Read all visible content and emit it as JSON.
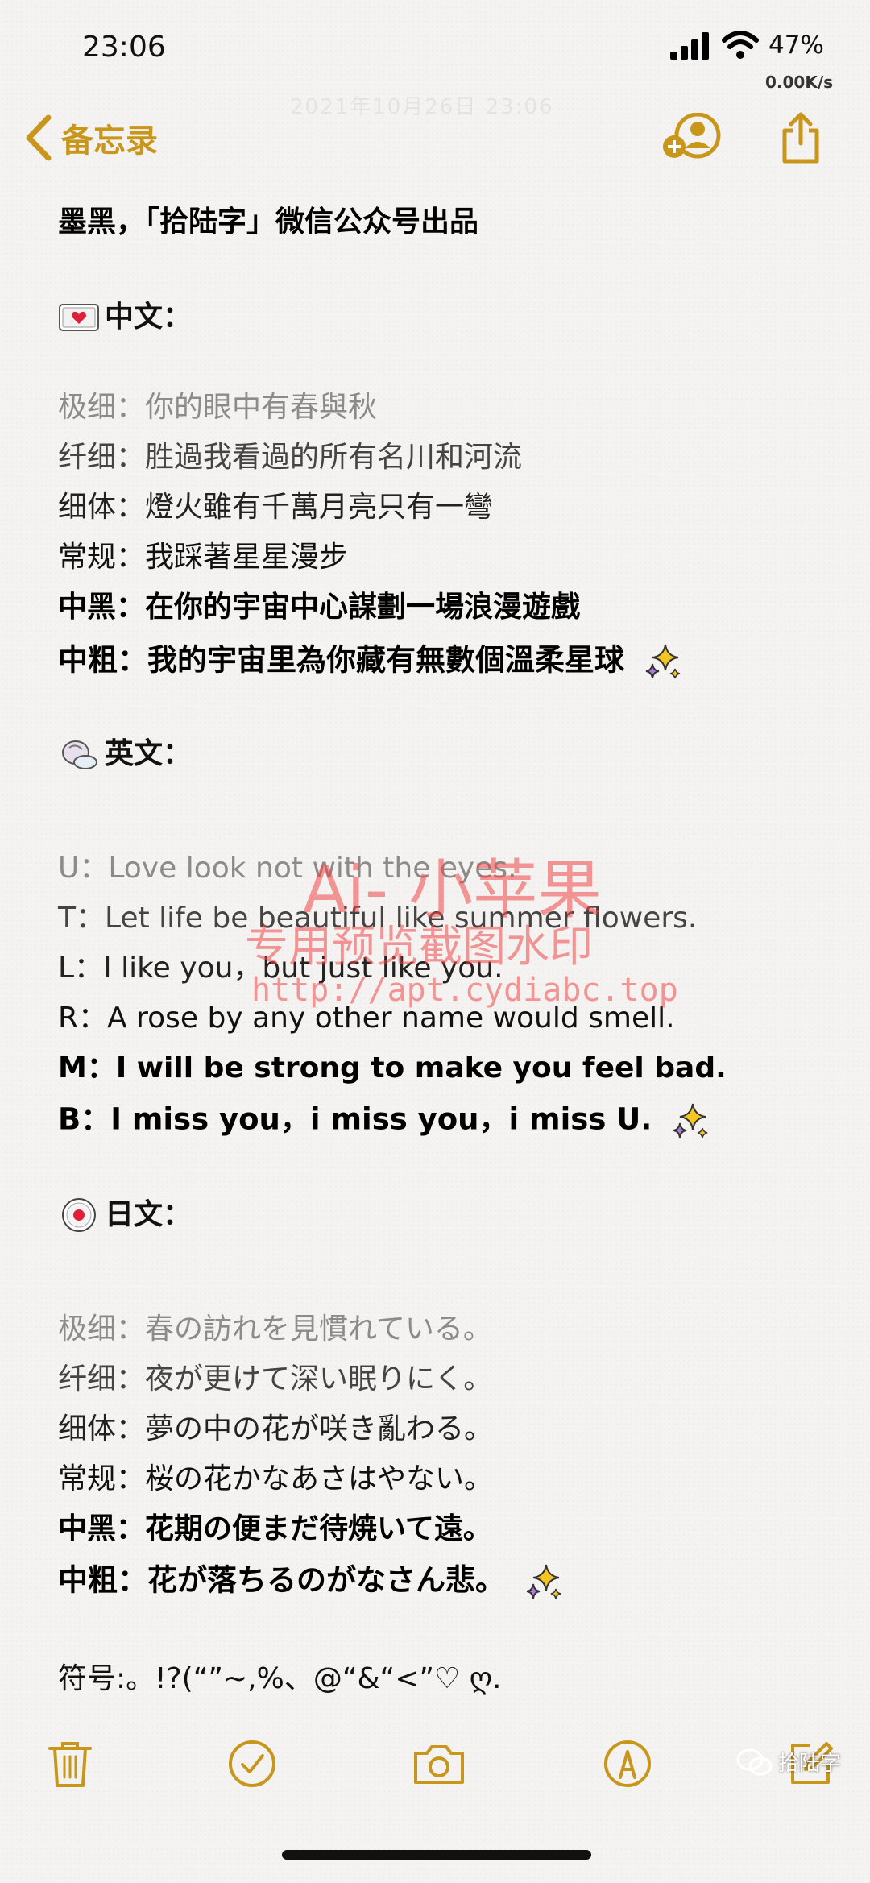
{
  "status_bar": {
    "time": "23:06",
    "battery": "47%",
    "net_speed": "0.00K/s",
    "faint_date": "2021年10月26日 23:06"
  },
  "nav": {
    "back_label": "备忘录",
    "accent_color": "#c8961a"
  },
  "note": {
    "title": "墨黑，「拾陆字」微信公众号出品",
    "sections": {
      "chinese": {
        "heading": "中文：",
        "icon": "flag-envelope-icon",
        "lines": [
          "极细：你的眼中有春與秋",
          "纤细：胜過我看過的所有名川和河流",
          "细体：燈火雖有千萬月亮只有一彎",
          "常规：我踩著星星漫步",
          "中黑：在你的宇宙中心謀劃一場浪漫遊戲",
          "中粗：我的宇宙里為你藏有無數個溫柔星球"
        ]
      },
      "english": {
        "heading": "英文：",
        "icon": "shell-icon",
        "lines": [
          "U：Love look not with the eyes.",
          "T：Let life be beautiful like summer flowers.",
          "L：I like you，but just like you.",
          "R：A rose by any other name would smell.",
          "M：I will be strong to make you feel bad.",
          "B：I miss you，i miss you，i miss U."
        ]
      },
      "japanese": {
        "heading": "日文：",
        "icon": "japan-flag-button-icon",
        "lines": [
          "极细：春の訪れを見慣れている。",
          "纤细：夜が更けて深い眠りにく。",
          "细体：夢の中の花が咲き亂わる。",
          "常规：桜の花かなあさはやない。",
          "中黑：花期の便まだ待焼いて遠。",
          "中粗：花が落ちるのがなさん悲。"
        ]
      }
    },
    "symbols": "符号:。!?(“”~,%、@“&“<”♡ ღ."
  },
  "watermark": {
    "line1": "Ai- 小苹果",
    "line2": "专用预览截图水印",
    "line3": "http://apt.cydiabc.top",
    "color": "#ee4646"
  },
  "credit": "拾陆字"
}
